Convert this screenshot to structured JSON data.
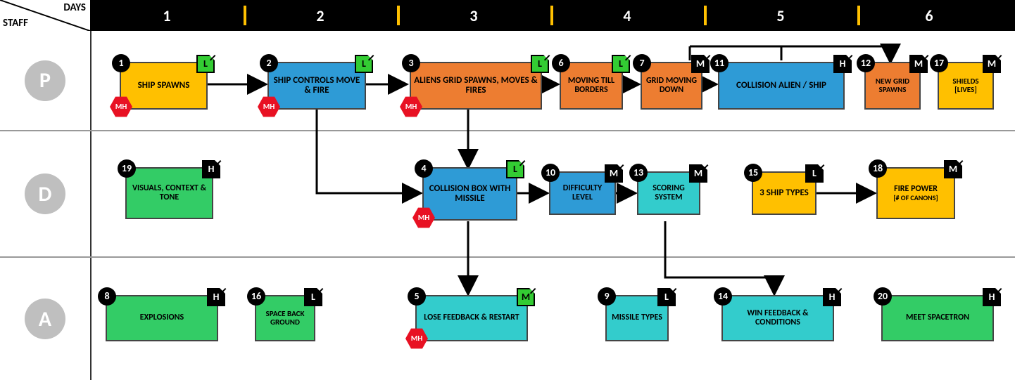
{
  "axis": {
    "staff": "STAFF",
    "days": "DAYS"
  },
  "days": [
    "1",
    "2",
    "3",
    "4",
    "5",
    "6"
  ],
  "rows": {
    "P": "P",
    "D": "D",
    "A": "A"
  },
  "mh_label": "MH",
  "cards": {
    "c1": {
      "num": "1",
      "pri": "L",
      "title": "SHIP SPAWNS"
    },
    "c2": {
      "num": "2",
      "pri": "L",
      "title": "SHIP CONTROLS MOVE & FIRE"
    },
    "c3": {
      "num": "3",
      "pri": "L",
      "title": "ALIENS GRID SPAWNS, MOVES & FIRES"
    },
    "c4": {
      "num": "4",
      "pri": "L",
      "title": "COLLISION BOX WITH MISSILE"
    },
    "c5": {
      "num": "5",
      "pri": "M",
      "title": "LOSE FEEDBACK & RESTART"
    },
    "c6": {
      "num": "6",
      "pri": "L",
      "title": "MOVING TILL BORDERS"
    },
    "c7": {
      "num": "7",
      "pri": "M",
      "title": "GRID MOVING DOWN"
    },
    "c8": {
      "num": "8",
      "pri": "H",
      "title": "EXPLOSIONS"
    },
    "c9": {
      "num": "9",
      "pri": "L",
      "title": "MISSILE TYPES"
    },
    "c10": {
      "num": "10",
      "pri": "M",
      "title": "DIFFICULTY LEVEL"
    },
    "c11": {
      "num": "11",
      "pri": "H",
      "title": "COLLISION ALIEN / SHIP"
    },
    "c12": {
      "num": "12",
      "pri": "M",
      "title": "NEW GRID SPAWNS"
    },
    "c13": {
      "num": "13",
      "pri": "M",
      "title": "SCORING SYSTEM"
    },
    "c14": {
      "num": "14",
      "pri": "H",
      "title": "WIN FEEDBACK & CONDITIONS"
    },
    "c15": {
      "num": "15",
      "pri": "L",
      "title": "3 SHIP TYPES"
    },
    "c16": {
      "num": "16",
      "pri": "L",
      "title": "SPACE BACK GROUND"
    },
    "c17": {
      "num": "17",
      "pri": "M",
      "title": "SHIELDS [LIVES]"
    },
    "c18": {
      "num": "18",
      "pri": "M",
      "title": "FIRE POWER",
      "sub": "[# OF CANONS]"
    },
    "c19": {
      "num": "19",
      "pri": "H",
      "title": "VISUALS, CONTEXT & TONE"
    },
    "c20": {
      "num": "20",
      "pri": "H",
      "title": "MEET SPACETRON"
    }
  }
}
